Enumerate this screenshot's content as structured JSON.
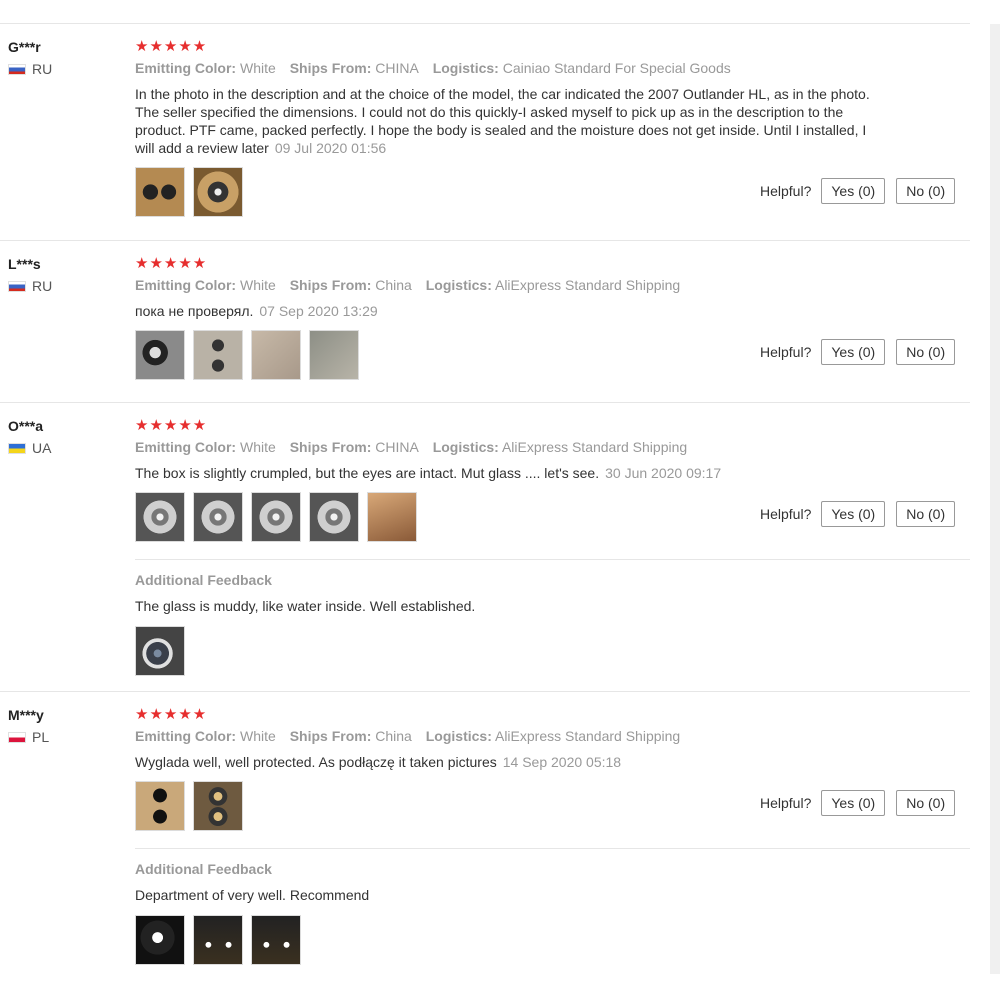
{
  "helpful_label": "Helpful?",
  "reviews": [
    {
      "user": "G***r",
      "country": "RU",
      "stars": "★★★★★",
      "attrs": {
        "color_label": "Emitting Color:",
        "color_value": "White",
        "ships_label": "Ships From:",
        "ships_value": "CHINA",
        "logistics_label": "Logistics:",
        "logistics_value": "Cainiao Standard For Special Goods"
      },
      "text": "In the photo in the description and at the choice of the model, the car indicated the 2007 Outlander HL, as in the photo. The seller specified the dimensions. I could not do this quickly-I asked myself to pick up as in the description to the product. PTF came, packed perfectly. I hope the body is sealed and the moisture does not get inside. Until I installed, I will add a review later",
      "date": "09 Jul 2020 01:56",
      "yes": "Yes (0)",
      "no": "No (0)"
    },
    {
      "user": "L***s",
      "country": "RU",
      "stars": "★★★★★",
      "attrs": {
        "color_label": "Emitting Color:",
        "color_value": "White",
        "ships_label": "Ships From:",
        "ships_value": "China",
        "logistics_label": "Logistics:",
        "logistics_value": "AliExpress Standard Shipping"
      },
      "text": "пока не проверял.",
      "date": "07 Sep 2020 13:29",
      "yes": "Yes (0)",
      "no": "No (0)"
    },
    {
      "user": "O***a",
      "country": "UA",
      "stars": "★★★★★",
      "attrs": {
        "color_label": "Emitting Color:",
        "color_value": "White",
        "ships_label": "Ships From:",
        "ships_value": "CHINA",
        "logistics_label": "Logistics:",
        "logistics_value": "AliExpress Standard Shipping"
      },
      "text": "The box is slightly crumpled, but the eyes are intact. Mut glass .... let's see.",
      "date": "30 Jun 2020 09:17",
      "yes": "Yes (0)",
      "no": "No (0)",
      "additional_title": "Additional Feedback",
      "additional_text": "The glass is muddy, like water inside. Well established."
    },
    {
      "user": "M***y",
      "country": "PL",
      "stars": "★★★★★",
      "attrs": {
        "color_label": "Emitting Color:",
        "color_value": "White",
        "ships_label": "Ships From:",
        "ships_value": "China",
        "logistics_label": "Logistics:",
        "logistics_value": "AliExpress Standard Shipping"
      },
      "text": "Wyglada well, well protected. As podłączę it taken pictures",
      "date": "14 Sep 2020 05:18",
      "yes": "Yes (0)",
      "no": "No (0)",
      "additional_title": "Additional Feedback",
      "additional_text": "Department of very well. Recommend"
    }
  ]
}
